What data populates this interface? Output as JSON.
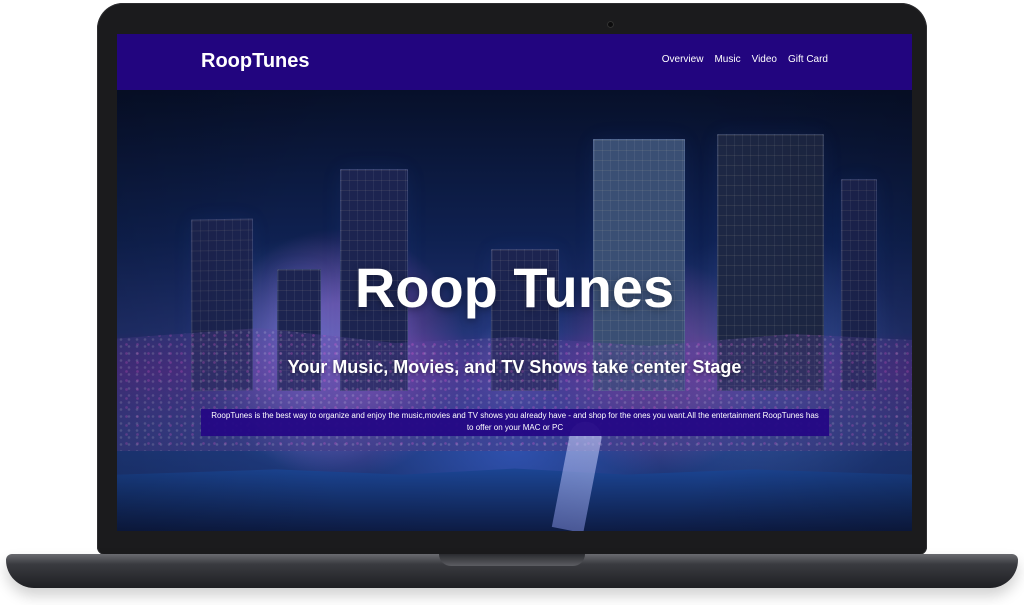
{
  "site": {
    "brand": "RoopTunes"
  },
  "nav": {
    "items": [
      {
        "label": "Overview"
      },
      {
        "label": "Music"
      },
      {
        "label": "Video"
      },
      {
        "label": "Gift Card"
      }
    ]
  },
  "hero": {
    "title": "Roop Tunes",
    "subtitle": "Your Music, Movies, and TV Shows take center Stage",
    "description": "RoopTunes is the best way to organize and enjoy the music,movies and TV shows you already have - and shop for the ones you want.All the entertainment RoopTunes has to offer on your MAC or PC"
  },
  "colors": {
    "nav_bg": "#22057f",
    "accent": "#240785",
    "text": "#ffffff"
  }
}
